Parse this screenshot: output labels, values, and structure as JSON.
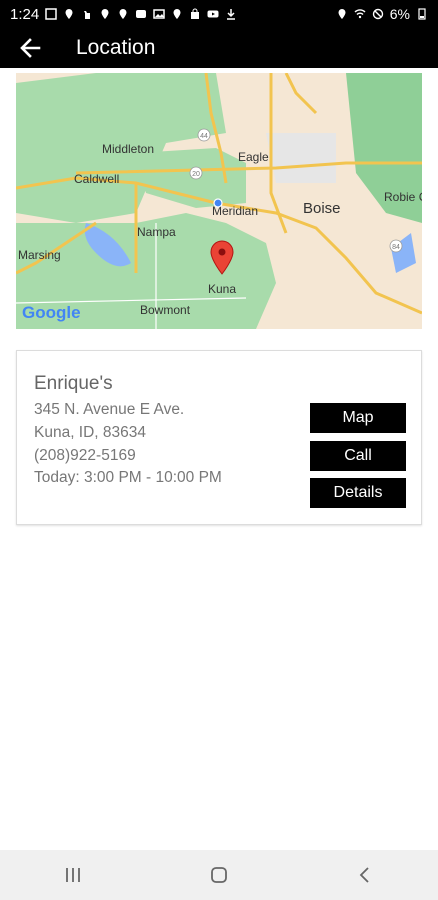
{
  "status": {
    "time": "1:24",
    "battery": "6%"
  },
  "appbar": {
    "title": "Location"
  },
  "map": {
    "brand": "Google",
    "labels": {
      "middleton": "Middleton",
      "eagle": "Eagle",
      "caldwell": "Caldwell",
      "meridian": "Meridian",
      "boise": "Boise",
      "robie": "Robie C",
      "nampa": "Nampa",
      "marsing": "Marsing",
      "kuna": "Kuna",
      "bowmont": "Bowmont",
      "shield_1": "44",
      "shield_2": "20",
      "shield_3": "84"
    }
  },
  "location": {
    "name": "Enrique's",
    "address1": "345 N. Avenue E Ave.",
    "address2": "Kuna, ID, 83634",
    "phone": "(208)922-5169",
    "hours": "Today: 3:00 PM - 10:00 PM",
    "buttons": {
      "map": "Map",
      "call": "Call",
      "details": "Details"
    }
  },
  "colors": {
    "bar": "#000000",
    "map_land": "#f5e7d4",
    "map_green": "#a8dbab",
    "map_water": "#8ab4f8",
    "road": "#f2c44f",
    "pin": "#ea4335"
  }
}
